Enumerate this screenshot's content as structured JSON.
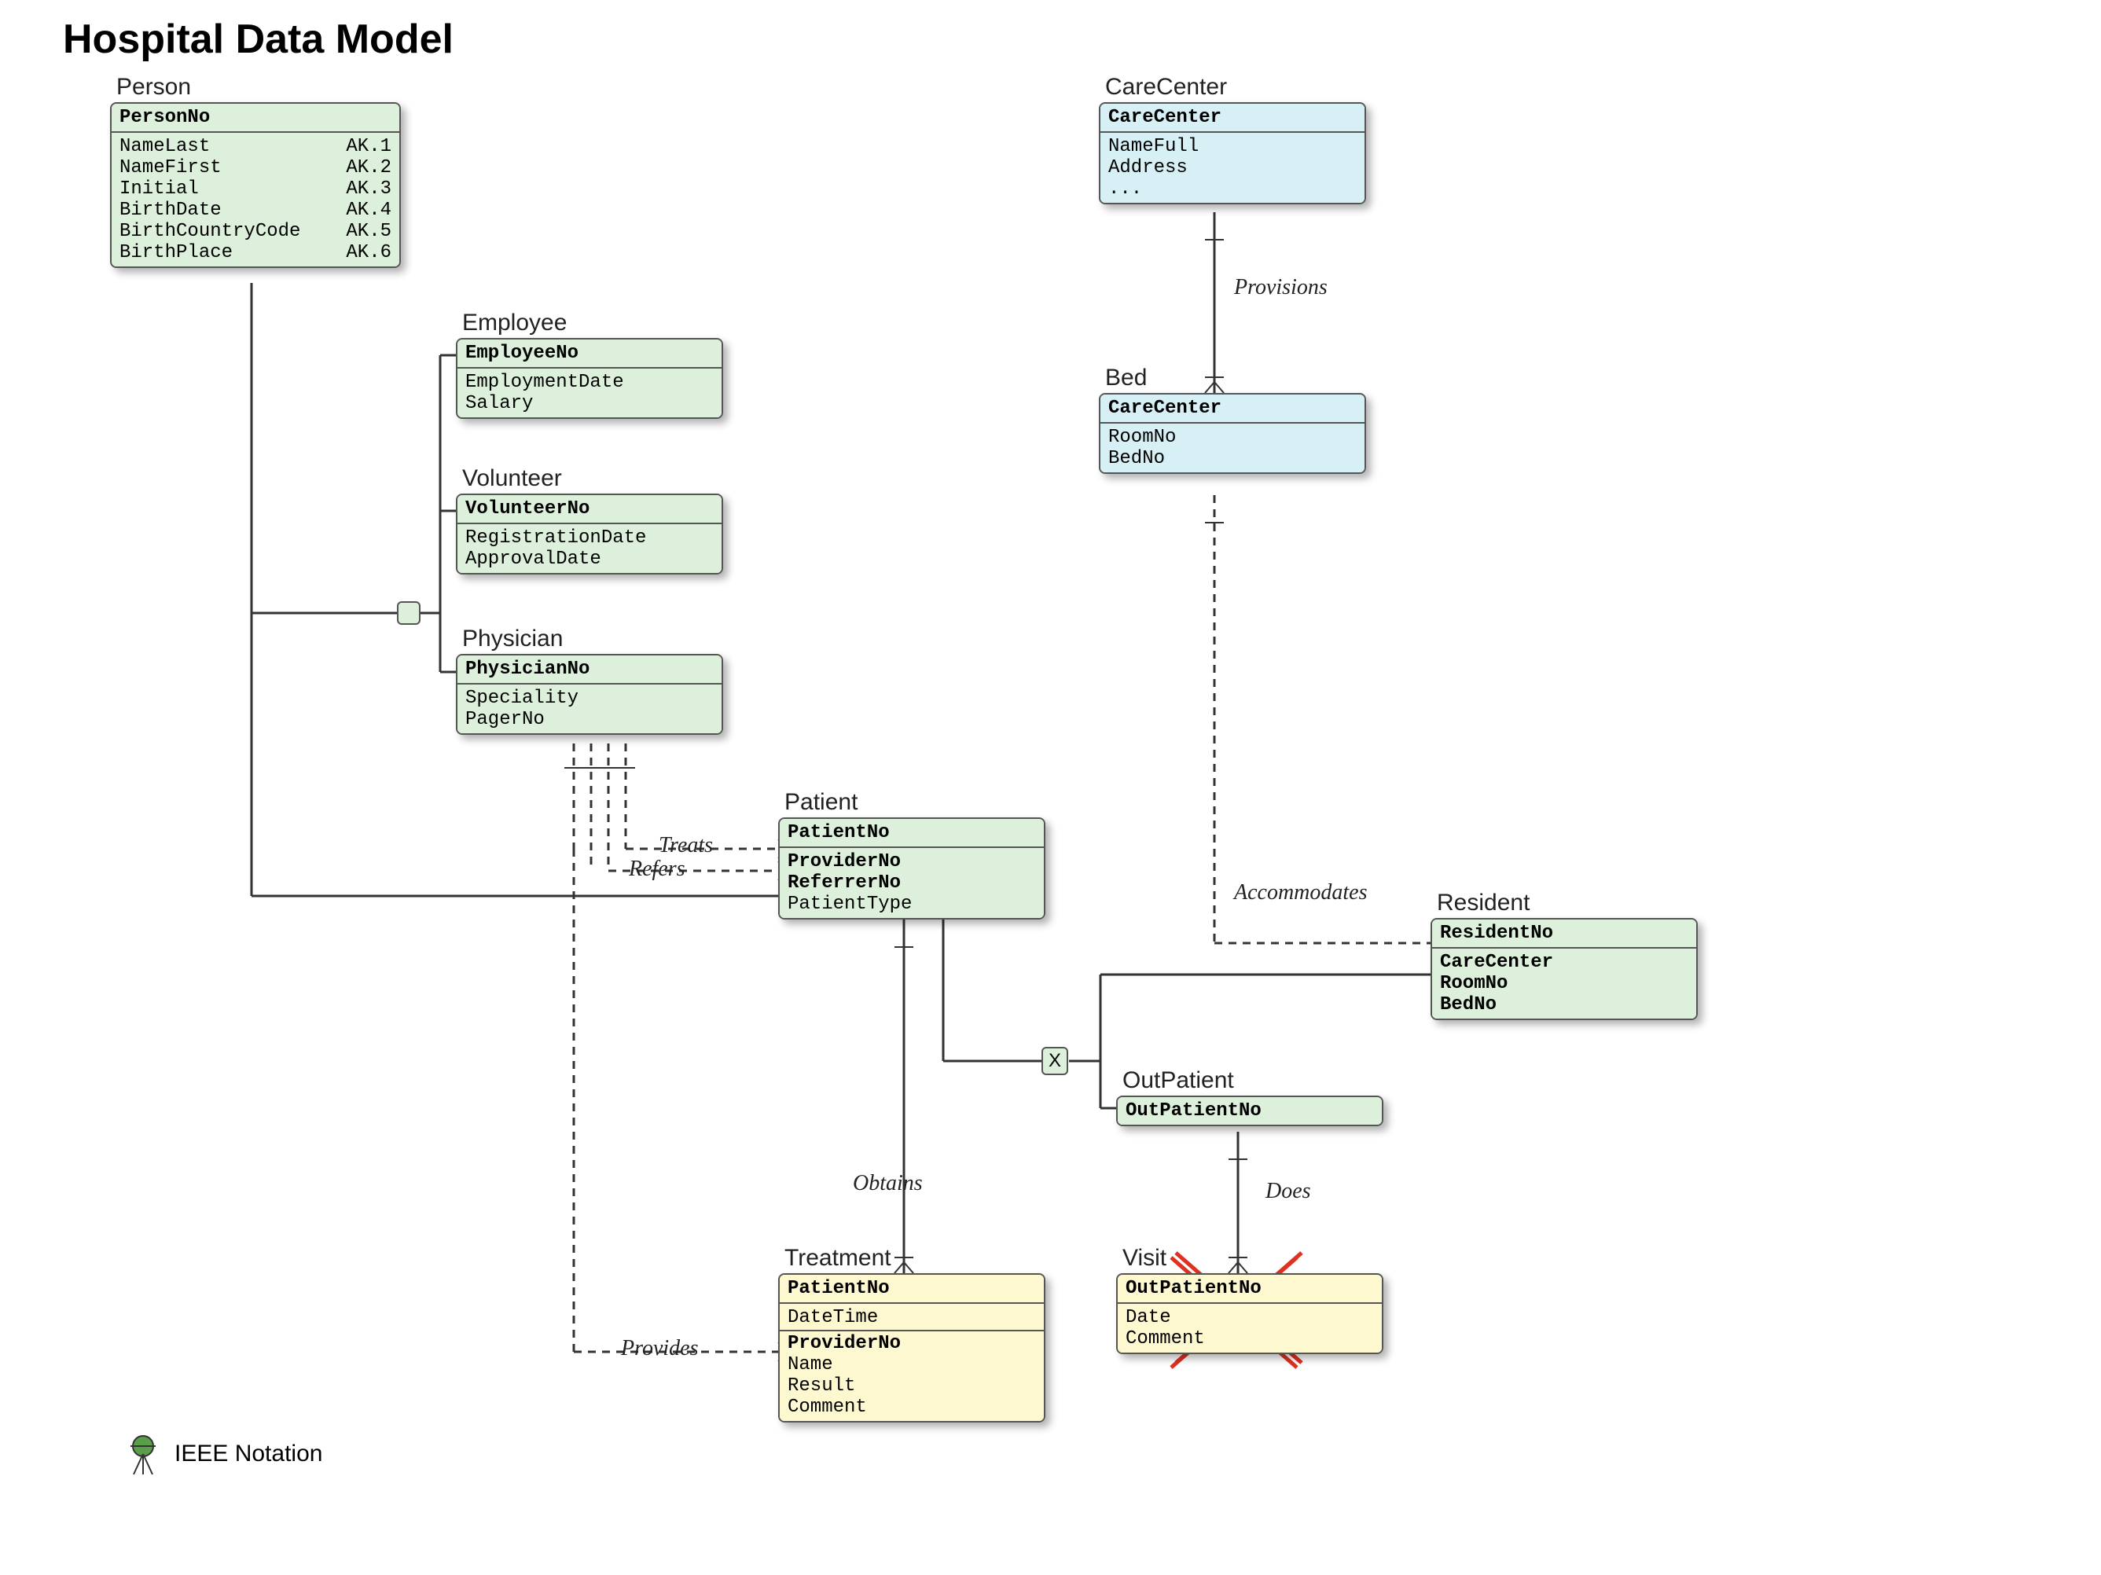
{
  "title": "Hospital Data Model",
  "notation": "IEEE Notation",
  "relationships": {
    "provisions": "Provisions",
    "accommodates": "Accommodates",
    "treats": "Treats",
    "refers": "Refers",
    "obtains": "Obtains",
    "provides": "Provides",
    "does": "Does"
  },
  "entities": {
    "person": {
      "title": "Person",
      "head": "PersonNo",
      "rows": [
        {
          "k": "NameLast",
          "v": "AK.1"
        },
        {
          "k": "NameFirst",
          "v": "AK.2"
        },
        {
          "k": "Initial",
          "v": "AK.3"
        },
        {
          "k": "BirthDate",
          "v": "AK.4"
        },
        {
          "k": "BirthCountryCode",
          "v": "AK.5"
        },
        {
          "k": "BirthPlace",
          "v": "AK.6"
        }
      ]
    },
    "employee": {
      "title": "Employee",
      "head": "EmployeeNo",
      "rows": [
        "EmploymentDate",
        "Salary"
      ]
    },
    "volunteer": {
      "title": "Volunteer",
      "head": "VolunteerNo",
      "rows": [
        "RegistrationDate",
        "ApprovalDate"
      ]
    },
    "physician": {
      "title": "Physician",
      "head": "PhysicianNo",
      "rows": [
        "Speciality",
        "PagerNo"
      ]
    },
    "patient": {
      "title": "Patient",
      "head": "PatientNo",
      "rows": [
        {
          "t": "ProviderNo",
          "bold": true
        },
        {
          "t": "ReferrerNo",
          "bold": true
        },
        {
          "t": "PatientType",
          "bold": false
        }
      ]
    },
    "carecenter": {
      "title": "CareCenter",
      "head": "CareCenter",
      "rows": [
        "NameFull",
        "Address",
        "..."
      ]
    },
    "bed": {
      "title": "Bed",
      "head": "CareCenter",
      "rows": [
        "RoomNo",
        "BedNo"
      ]
    },
    "resident": {
      "title": "Resident",
      "head": "ResidentNo",
      "rows": [
        {
          "t": "CareCenter",
          "bold": true
        },
        {
          "t": "RoomNo",
          "bold": true
        },
        {
          "t": "BedNo",
          "bold": true
        }
      ]
    },
    "outpatient": {
      "title": "OutPatient",
      "head": "OutPatientNo"
    },
    "treatment": {
      "title": "Treatment",
      "head": "PatientNo",
      "rows": [
        "DateTime",
        {
          "t": "ProviderNo",
          "bold": true,
          "sep": true
        },
        "Name",
        "Result",
        "Comment"
      ]
    },
    "visit": {
      "title": "Visit",
      "head": "OutPatientNo",
      "rows": [
        "Date",
        "Comment"
      ]
    }
  }
}
